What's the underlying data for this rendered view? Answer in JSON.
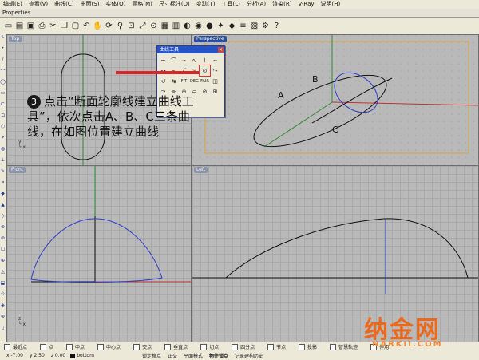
{
  "menu": {
    "items": [
      "编辑(E)",
      "查看(V)",
      "曲线(C)",
      "曲面(S)",
      "实体(O)",
      "网格(M)",
      "尺寸标注(D)",
      "变动(T)",
      "工具(L)",
      "分析(A)",
      "渲染(R)",
      "V-Ray",
      "说明(H)"
    ]
  },
  "properties_bar": {
    "label": "Properties"
  },
  "toolbar_icons": [
    "new-file-icon",
    "open-icon",
    "save-icon",
    "print-icon",
    "cut-icon",
    "copy-icon",
    "paste-icon",
    "undo-icon",
    "pan-icon",
    "rotate-view-icon",
    "zoom-icon",
    "zoom-window-icon",
    "zoom-extents-icon",
    "zoom-selected-icon",
    "grid-icon",
    "viewport-icon",
    "shade-icon",
    "render-icon",
    "sphere-icon",
    "light-icon",
    "material-icon",
    "layer-icon",
    "properties-icon",
    "options-icon",
    "help-icon"
  ],
  "viewports": {
    "top": {
      "label": "Top"
    },
    "perspective": {
      "label": "Perspective"
    },
    "front": {
      "label": "Front"
    },
    "left": {
      "label": "Left"
    }
  },
  "curve_panel": {
    "title": "曲线工具",
    "close": "×",
    "tools": [
      "⌐",
      "⌒",
      "∽",
      "∿",
      "⌇",
      "∼",
      "↝",
      "⌁",
      "⟋",
      "⌣",
      "⊙",
      "↷",
      "↺",
      "↹",
      "FIT",
      "DEG",
      "FAIR",
      "◫",
      "⤳",
      "⌯",
      "⊕",
      "⌓",
      "⊘",
      "⊞"
    ]
  },
  "instruction": {
    "step": "3",
    "text": "点击“断面轮廓线建立曲线工具”，依次点击A、B、C三条曲线，在如图位置建立曲线"
  },
  "curve_labels": {
    "a": "A",
    "b": "B",
    "c": "C"
  },
  "snap_options": [
    "最近点",
    "点",
    "中点",
    "中心点",
    "交点",
    "垂直点",
    "切点",
    "四分点",
    "节点",
    "投影",
    "智慧轨迹",
    "停用"
  ],
  "status": {
    "x": "x -7.00",
    "y": "y 2.50",
    "z": "z 0.00",
    "layer_swatch_color": "#111111",
    "layer": "bottom",
    "grid_snap": "锁定格点",
    "ortho": "正交",
    "planar": "平面模式",
    "osnap": "物件锁点",
    "history": "记录建构历史"
  },
  "watermark": {
    "logo": "纳金网",
    "url": "NARKII.COM"
  }
}
